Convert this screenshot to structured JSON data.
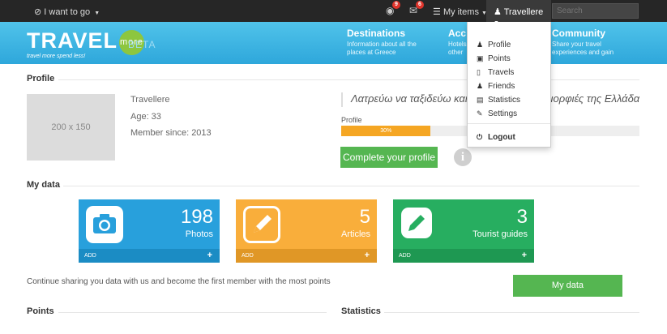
{
  "topbar": {
    "goto_label": "I want to go",
    "notif_globe_count": "9",
    "notif_mail_count": "6",
    "my_items_label": "My items",
    "user_label": "Travellere",
    "search_placeholder": "Search"
  },
  "header": {
    "logo_travel": "TRAVEL",
    "logo_more": "more",
    "logo_beta": "BETA",
    "logo_tagline": "travel more spend less!",
    "nav": [
      {
        "title": "Destinations",
        "desc1": "Information about all the",
        "desc2": "places at Greece"
      },
      {
        "title": "Acc",
        "desc1": "Hotels",
        "desc2": "other"
      },
      {
        "title": "Community",
        "desc1": "Share your travel",
        "desc2": "experiences and gain"
      }
    ]
  },
  "profile": {
    "section_title": "Profile",
    "photo_placeholder": "200 x 150",
    "name": "Travellere",
    "age": "Age: 33",
    "member_since": "Member since: 2013",
    "quote": "Λατρεύω να ταξιδεύω και να γνωρίζω τις ομορφιές της Ελλάδας",
    "progress_label": "Profile",
    "progress_text": "30%",
    "progress_value": 0.3,
    "complete_button": "Complete your profile"
  },
  "my_data": {
    "section_title": "My data",
    "cards": [
      {
        "count": "198",
        "label": "Photos",
        "add": "ADD",
        "color": "#28a0dc",
        "footer_color": "#1b8cc4",
        "icon": "camera-icon"
      },
      {
        "count": "5",
        "label": "Articles",
        "add": "ADD",
        "color": "#f9ae3b",
        "footer_color": "#e09726",
        "icon": "edit-icon"
      },
      {
        "count": "3",
        "label": "Tourist guides",
        "add": "ADD",
        "color": "#27ae60",
        "footer_color": "#1e9852",
        "icon": "pencil-icon"
      }
    ],
    "cta_text": "Continue sharing you data with us and become the first member with the most points",
    "cta_button": "My data"
  },
  "bottom": {
    "points_title": "Points",
    "statistics_title": "Statistics"
  },
  "dropdown": {
    "items": [
      {
        "label": "Profile",
        "icon": "user-icon"
      },
      {
        "label": "Points",
        "icon": "points-icon"
      },
      {
        "label": "Travels",
        "icon": "file-icon"
      },
      {
        "label": "Friends",
        "icon": "group-icon"
      },
      {
        "label": "Statistics",
        "icon": "chart-icon"
      },
      {
        "label": "Settings",
        "icon": "settings-icon"
      }
    ],
    "logout": "Logout"
  }
}
